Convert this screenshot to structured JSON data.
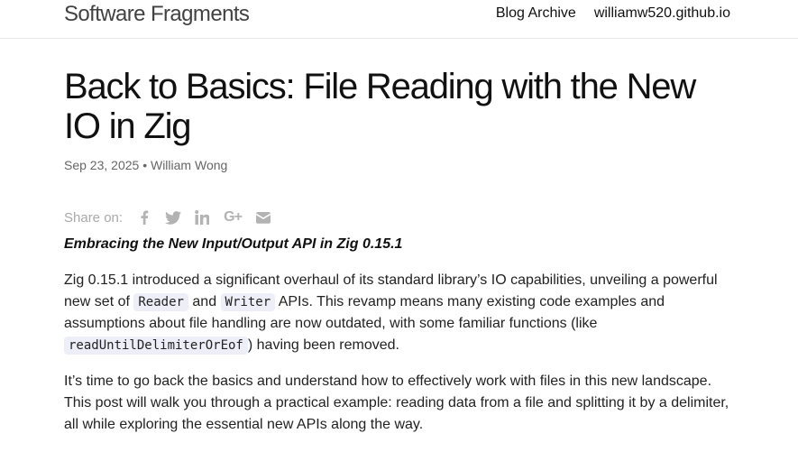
{
  "header": {
    "site_title": "Software Fragments",
    "nav": [
      {
        "label": "Blog Archive"
      },
      {
        "label": "williamw520.github.io"
      }
    ]
  },
  "post": {
    "title": "Back to Basics: File Reading with the New IO in Zig",
    "date": "Sep 23, 2025",
    "separator": "•",
    "author": "William Wong",
    "share_label": "Share on:",
    "share_icons": [
      "facebook-icon",
      "twitter-icon",
      "linkedin-icon",
      "google-plus-icon",
      "email-icon"
    ],
    "google_plus_text": "G+",
    "lead": "Embracing the New Input/Output API in Zig 0.15.1",
    "p1": {
      "t1": "Zig 0.15.1 introduced a significant overhaul of its standard library’s IO capabilities, unveiling a powerful new set of ",
      "code1": "Reader",
      "t2": " and ",
      "code2": "Writer",
      "t3": " APIs. This revamp means many existing code examples and assumptions about file handling are now outdated, with some familiar functions (like ",
      "code3": "readUntilDelimiterOrEof",
      "t4": ") having been removed."
    },
    "p2": "It’s time to go back the basics and understand how to effectively work with files in this new landscape. This post will walk you through a practical example: reading data from a file and splitting it by a delimiter, all while exploring the essential new APIs along the way."
  }
}
